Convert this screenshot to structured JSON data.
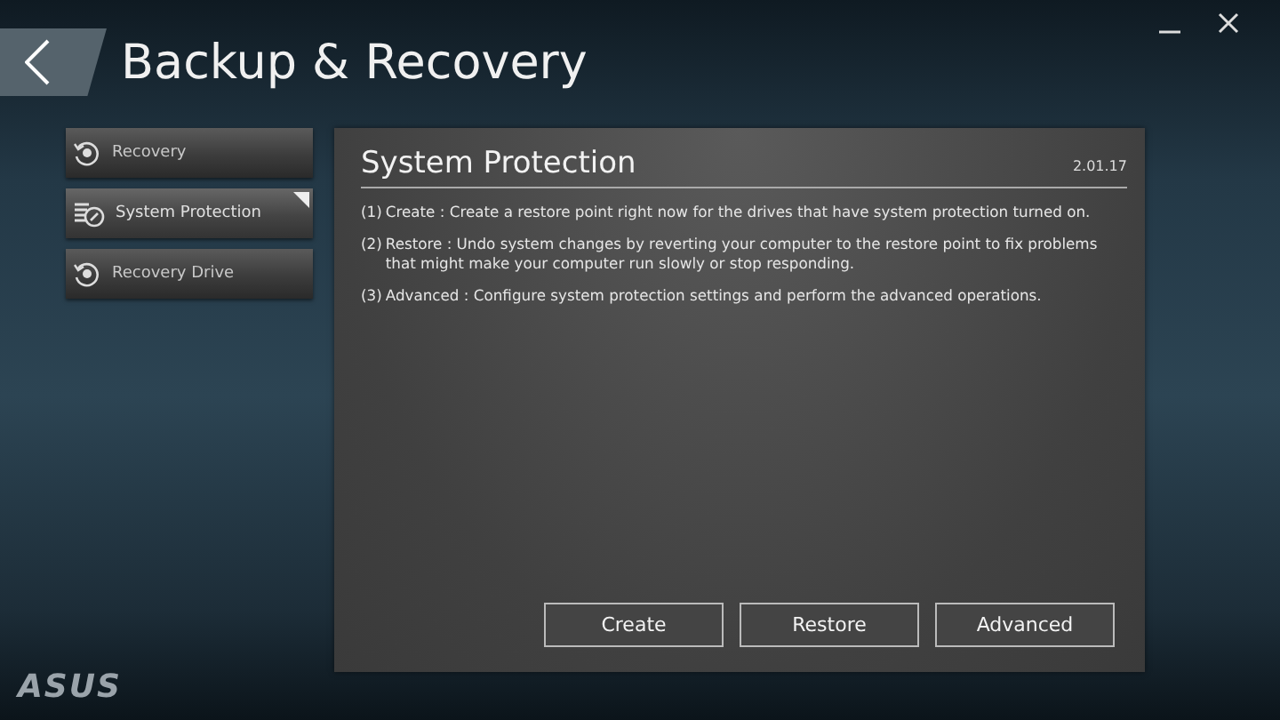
{
  "window": {
    "title": "Backup & Recovery"
  },
  "sidebar": {
    "items": [
      {
        "label": "Recovery",
        "kind": "recovery",
        "selected": false
      },
      {
        "label": "System Protection",
        "kind": "protection",
        "selected": true
      },
      {
        "label": "Recovery Drive",
        "kind": "recovery",
        "selected": false
      }
    ]
  },
  "panel": {
    "title": "System Protection",
    "version": "2.01.17",
    "paragraphs": [
      {
        "number": "(1)",
        "text": "Create : Create a restore point right now for the drives that have system protection turned on."
      },
      {
        "number": "(2)",
        "text": "Restore : Undo system changes by reverting  your computer to the restore point to fix problems that might make your computer run slowly or stop responding."
      },
      {
        "number": "(3)",
        "text": "Advanced : Configure system protection settings and perform the advanced operations."
      }
    ],
    "buttons": [
      "Create",
      "Restore",
      "Advanced"
    ]
  },
  "logo": "ASUS"
}
